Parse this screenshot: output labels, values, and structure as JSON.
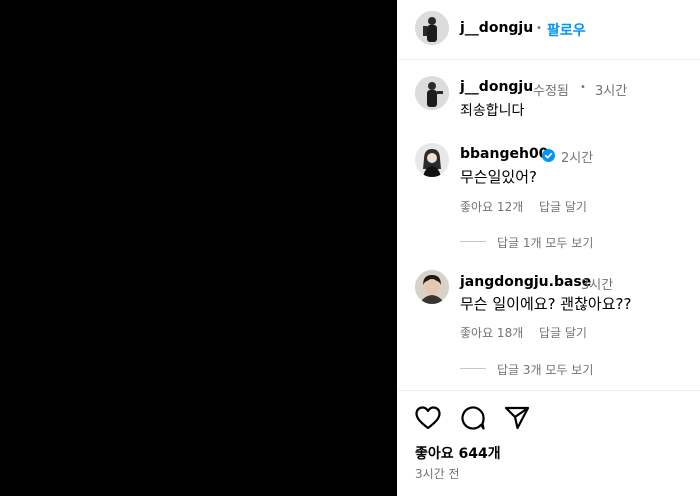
{
  "post": {
    "author": "j__dongju",
    "follow_label": "팔로우",
    "dot": "•"
  },
  "caption": {
    "username": "j__dongju",
    "edited": "수정됨",
    "dot": "•",
    "time": "3시간",
    "text": "죄송합니다"
  },
  "comments": [
    {
      "username": "bbangeh00",
      "verified": true,
      "time": "2시간",
      "text": "무슨일있어?",
      "likes": "좋아요 12개",
      "reply": "답글 달기",
      "view_replies": "답글 1개 모두 보기"
    },
    {
      "username": "jangdongju.base",
      "verified": false,
      "time": "3시간",
      "text": "무슨 일이에요? 괜찮아요??",
      "likes": "좋아요 18개",
      "reply": "답글 달기",
      "view_replies": "답글 3개 모두 보기"
    }
  ],
  "footer": {
    "likes": "좋아요 644개",
    "time": "3시간 전"
  },
  "colors": {
    "accent": "#0095f6",
    "muted": "#737373",
    "media_bg": "#000000"
  },
  "icons": [
    "heart-icon",
    "comment-icon",
    "share-icon",
    "verified-badge-icon"
  ]
}
